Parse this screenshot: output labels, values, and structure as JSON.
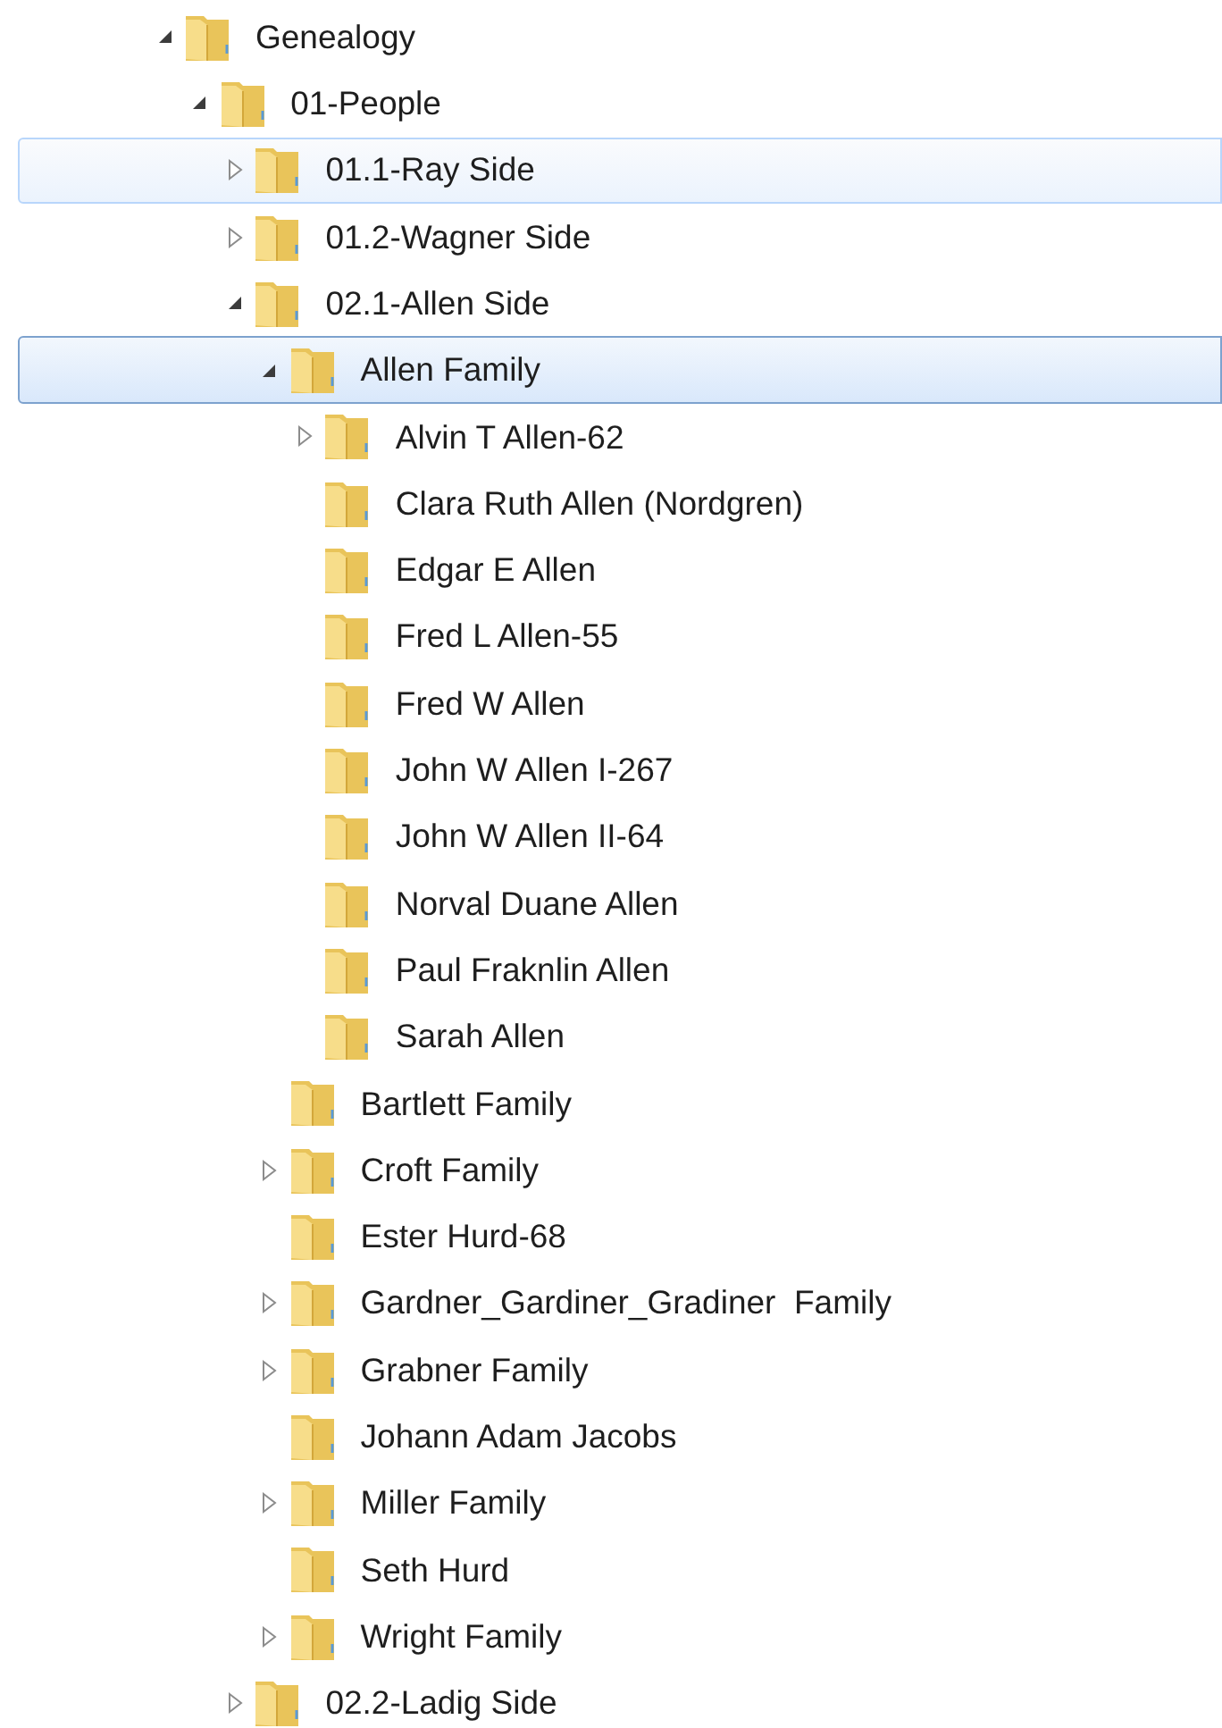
{
  "tree": [
    {
      "label": "Genealogy",
      "expanded": true,
      "selected": false,
      "hover": false,
      "children": [
        {
          "label": "01-People",
          "expanded": true,
          "selected": false,
          "hover": false,
          "children": [
            {
              "label": "01.1-Ray Side",
              "expanded": false,
              "selected": false,
              "hover": true
            },
            {
              "label": "01.2-Wagner Side",
              "expanded": false,
              "selected": false,
              "hover": false
            },
            {
              "label": "02.1-Allen Side",
              "expanded": true,
              "selected": false,
              "hover": false,
              "children": [
                {
                  "label": "Allen Family",
                  "expanded": true,
                  "selected": true,
                  "hover": false,
                  "children": [
                    {
                      "label": "Alvin T Allen-62",
                      "expanded": false,
                      "selected": false,
                      "hover": false
                    },
                    {
                      "label": "Clara Ruth Allen (Nordgren)",
                      "selected": false,
                      "hover": false
                    },
                    {
                      "label": "Edgar E Allen",
                      "selected": false,
                      "hover": false
                    },
                    {
                      "label": "Fred L Allen-55",
                      "selected": false,
                      "hover": false
                    },
                    {
                      "label": "Fred W Allen",
                      "selected": false,
                      "hover": false
                    },
                    {
                      "label": "John W Allen I-267",
                      "selected": false,
                      "hover": false
                    },
                    {
                      "label": "John W Allen II-64",
                      "selected": false,
                      "hover": false
                    },
                    {
                      "label": "Norval Duane Allen",
                      "selected": false,
                      "hover": false
                    },
                    {
                      "label": "Paul Fraknlin Allen",
                      "selected": false,
                      "hover": false
                    },
                    {
                      "label": "Sarah Allen",
                      "selected": false,
                      "hover": false
                    }
                  ]
                },
                {
                  "label": "Bartlett Family",
                  "selected": false,
                  "hover": false
                },
                {
                  "label": "Croft Family",
                  "expanded": false,
                  "selected": false,
                  "hover": false
                },
                {
                  "label": "Ester Hurd-68",
                  "selected": false,
                  "hover": false
                },
                {
                  "label": "Gardner_Gardiner_Gradiner  Family",
                  "expanded": false,
                  "selected": false,
                  "hover": false
                },
                {
                  "label": "Grabner Family",
                  "expanded": false,
                  "selected": false,
                  "hover": false
                },
                {
                  "label": "Johann Adam Jacobs",
                  "selected": false,
                  "hover": false
                },
                {
                  "label": "Miller Family",
                  "expanded": false,
                  "selected": false,
                  "hover": false
                },
                {
                  "label": "Seth Hurd",
                  "selected": false,
                  "hover": false
                },
                {
                  "label": "Wright Family",
                  "expanded": false,
                  "selected": false,
                  "hover": false
                }
              ]
            },
            {
              "label": "02.2-Ladig Side",
              "expanded": false,
              "selected": false,
              "hover": false
            }
          ]
        }
      ]
    }
  ]
}
